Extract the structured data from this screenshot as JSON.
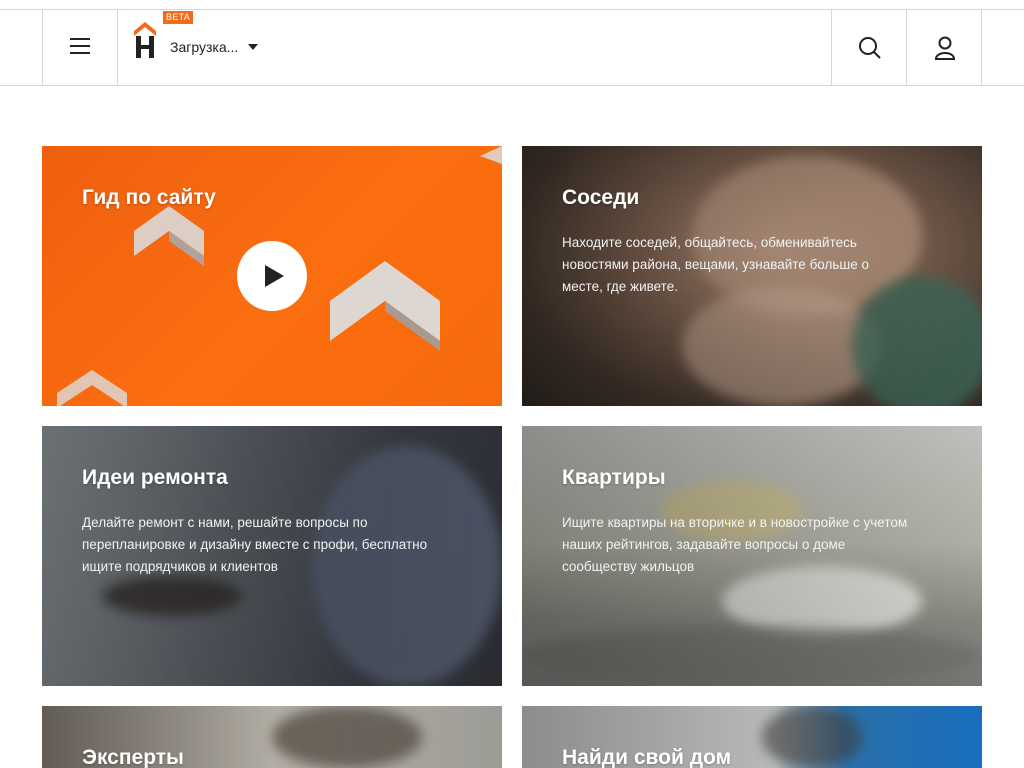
{
  "header": {
    "logo_text": "H",
    "beta_label": "BETA",
    "location_label": "Загрузка...",
    "icons": {
      "menu": "hamburger-menu-icon",
      "search": "search-icon",
      "user": "user-icon",
      "dropdown": "chevron-down-icon"
    }
  },
  "cards": [
    {
      "title": "Гид по сайту",
      "description": ""
    },
    {
      "title": "Соседи",
      "description": "Находите соседей, общайтесь, обменивайтесь новостями района, вещами, узнавайте больше о месте, где живете."
    },
    {
      "title": "Идеи ремонта",
      "description": "Делайте ремонт с нами, решайте вопросы по перепланировке и дизайну вместе с профи, бесплатно ищите подрядчиков и клиентов"
    },
    {
      "title": "Квартиры",
      "description": "Ищите квартиры на вторичке и в новостройке с учетом наших рейтингов, задавайте вопросы о доме сообществу жильцов"
    },
    {
      "title": "Эксперты",
      "description": ""
    },
    {
      "title": "Найди свой дом",
      "description": ""
    }
  ],
  "colors": {
    "brand_orange": "#f26b1d",
    "border": "#d7d7d7"
  }
}
